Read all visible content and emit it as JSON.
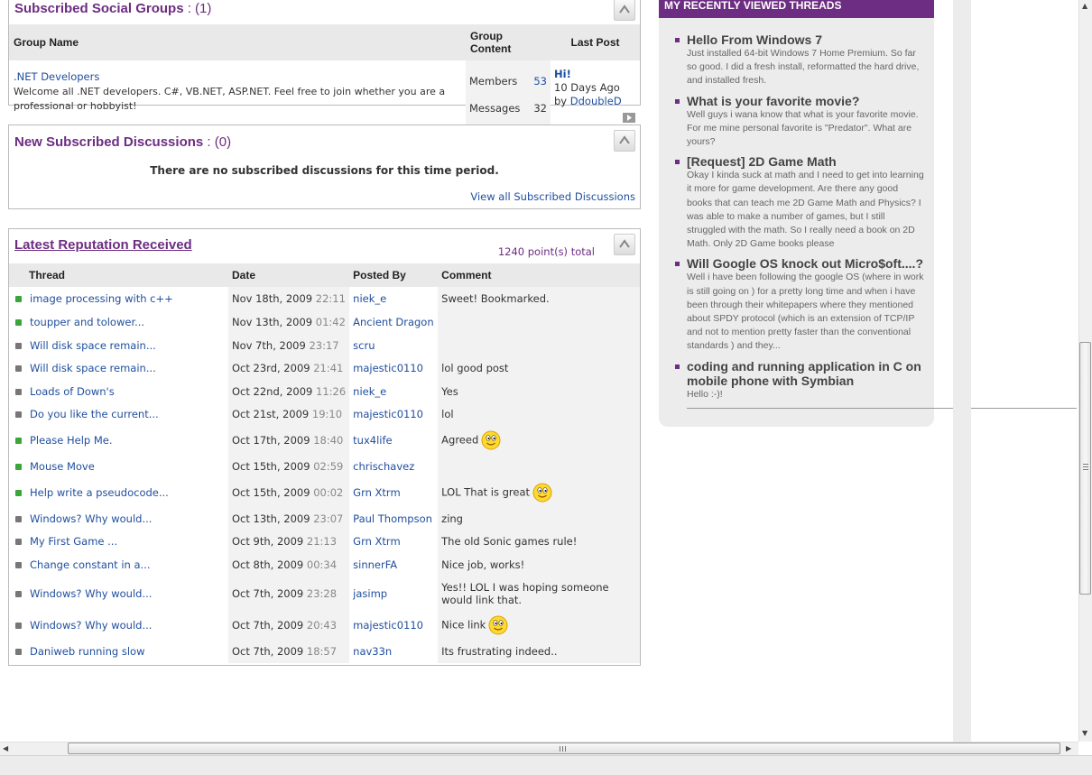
{
  "groups": {
    "title": "Subscribed Social Groups",
    "count": " : (1)",
    "col_name": "Group Name",
    "col_content": "Group Content",
    "col_last": "Last Post",
    "item": {
      "name": ".NET Developers",
      "description": "Welcome all .NET developers. C#, VB.NET, ASP.NET. Feel free to join whether you are a professional or hobbyist!",
      "members_label": "Members",
      "members": "53",
      "messages_label": "Messages",
      "messages": "32",
      "last_title": "Hi!",
      "last_when": "10 Days Ago",
      "last_by_prefix": "by ",
      "last_by": "DdoubleD"
    }
  },
  "discussions": {
    "title": "New Subscribed Discussions",
    "count": " : (0)",
    "empty": "There are no subscribed discussions for this time period.",
    "view_all": "View all Subscribed Discussions"
  },
  "reputation": {
    "title": "Latest Reputation Received",
    "total": "1240 point(s) total",
    "columns": [
      "Thread",
      "Date",
      "Posted By",
      "Comment"
    ],
    "rows": [
      {
        "status": "green",
        "thread": "image processing with c++",
        "date": "Nov 18th, 2009",
        "time": "22:11",
        "by": "niek_e",
        "comment": "Sweet! Bookmarked.",
        "smiley": false
      },
      {
        "status": "green",
        "thread": "toupper and tolower...",
        "date": "Nov 13th, 2009",
        "time": "01:42",
        "by": "Ancient Dragon",
        "comment": "",
        "smiley": false
      },
      {
        "status": "gray",
        "thread": "Will disk space remain...",
        "date": "Nov 7th, 2009",
        "time": "23:17",
        "by": "scru",
        "comment": "",
        "smiley": false
      },
      {
        "status": "gray",
        "thread": "Will disk space remain...",
        "date": "Oct 23rd, 2009",
        "time": "21:41",
        "by": "majestic0110",
        "comment": "lol good post",
        "smiley": false
      },
      {
        "status": "gray",
        "thread": "Loads of Down's",
        "date": "Oct 22nd, 2009",
        "time": "11:26",
        "by": "niek_e",
        "comment": "Yes",
        "smiley": false
      },
      {
        "status": "gray",
        "thread": "Do you like the current...",
        "date": "Oct 21st, 2009",
        "time": "19:10",
        "by": "majestic0110",
        "comment": "lol",
        "smiley": false
      },
      {
        "status": "green",
        "thread": "Please Help Me.",
        "date": "Oct 17th, 2009",
        "time": "18:40",
        "by": "tux4life",
        "comment": "Agreed",
        "smiley": true
      },
      {
        "status": "green",
        "thread": "Mouse Move",
        "date": "Oct 15th, 2009",
        "time": "02:59",
        "by": "chrischavez",
        "comment": "",
        "smiley": false
      },
      {
        "status": "green",
        "thread": "Help write a pseudocode...",
        "date": "Oct 15th, 2009",
        "time": "00:02",
        "by": "Grn Xtrm",
        "comment": "LOL That is great",
        "smiley": true
      },
      {
        "status": "gray",
        "thread": "Windows? Why would...",
        "date": "Oct 13th, 2009",
        "time": "23:07",
        "by": "Paul Thompson",
        "comment": "zing",
        "smiley": false
      },
      {
        "status": "gray",
        "thread": "My First Game ...",
        "date": "Oct 9th, 2009",
        "time": "21:13",
        "by": "Grn Xtrm",
        "comment": "The old Sonic games rule!",
        "smiley": false
      },
      {
        "status": "gray",
        "thread": "Change constant in a...",
        "date": "Oct 8th, 2009",
        "time": "00:34",
        "by": "sinnerFA",
        "comment": "Nice job, works!",
        "smiley": false
      },
      {
        "status": "gray",
        "thread": "Windows? Why would...",
        "date": "Oct 7th, 2009",
        "time": "23:28",
        "by": "jasimp",
        "comment": "Yes!! LOL I was hoping someone would link that.",
        "smiley": false
      },
      {
        "status": "gray",
        "thread": "Windows? Why would...",
        "date": "Oct 7th, 2009",
        "time": "20:43",
        "by": "majestic0110",
        "comment": "Nice link",
        "smiley": true
      },
      {
        "status": "gray",
        "thread": "Daniweb running slow",
        "date": "Oct 7th, 2009",
        "time": "18:57",
        "by": "nav33n",
        "comment": "Its frustrating indeed..",
        "smiley": false
      }
    ]
  },
  "recent_threads": {
    "title": "MY RECENTLY VIEWED THREADS",
    "items": [
      {
        "title": "Hello From Windows 7",
        "snippet": "Just installed 64-bit Windows 7 Home Premium. So far so good. I did a fresh install, reformatted the hard drive, and installed fresh."
      },
      {
        "title": "What is your favorite movie?",
        "snippet": "Well guys i wana know that what is your favorite movie. For me mine personal favorite is \"Predator\". What are yours?"
      },
      {
        "title": "[Request] 2D Game Math",
        "snippet": "Okay I kinda suck at math and I need to get into learning it more for game development. Are there any good books that can teach me 2D Game Math and Physics? I was able to make a number of games, but I still struggled with the math. So I really need a book on 2D Math. Only 2D Game books please"
      },
      {
        "title": "Will Google OS knock out Micro$oft....?",
        "snippet": "Well i have been following the google OS (where in work is still going on ) for a pretty long time and when i have been through their whitepapers where they mentioned about SPDY protocol (which is an extension of TCP/IP and not to mention pretty faster than the conventional standards ) and they..."
      },
      {
        "title": "coding and running application in C on mobile phone with Symbian",
        "snippet": "Hello :-)!"
      }
    ]
  },
  "colors": {
    "accent": "#6d2d82",
    "link": "#1f4e9e",
    "status_green": "#3aa63a",
    "status_gray": "#777777"
  }
}
